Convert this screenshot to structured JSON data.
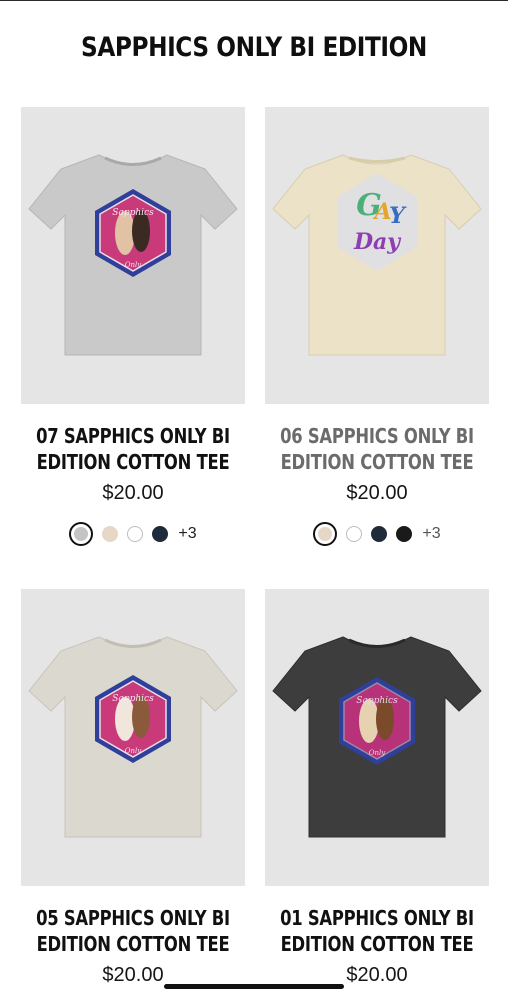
{
  "page": {
    "title": "SAPPHICS ONLY BI EDITION"
  },
  "products": [
    {
      "title_line1": "07 SAPPHICS ONLY BI",
      "title_line2": "EDITION COTTON TEE",
      "price": "$20.00",
      "shirt_color": "#c9c9c9",
      "swatches": [
        "#c4c4c4",
        "#e6d7c6",
        "#ffffff",
        "#1f2a3a"
      ],
      "more_colors": "+3"
    },
    {
      "title_line1": "06 SAPPHICS ONLY BI",
      "title_line2": "EDITION COTTON TEE",
      "price": "$20.00",
      "shirt_color": "#ece2c8",
      "swatches": [
        "#e6d7c6",
        "#ffffff",
        "#1f2a3a",
        "#1a1a1a"
      ],
      "more_colors": "+3"
    },
    {
      "title_line1": "05 SAPPHICS ONLY BI",
      "title_line2": "EDITION COTTON TEE",
      "price": "$20.00",
      "shirt_color": "#dbd8cf"
    },
    {
      "title_line1": "01 SAPPHICS ONLY BI",
      "title_line2": "EDITION COTTON TEE",
      "price": "$20.00",
      "shirt_color": "#3d3d3d"
    }
  ],
  "design": {
    "hex_border_blue": "#2f3f9a",
    "hex_border_purple": "#7a3a94",
    "hex_fill": "#c93a7a",
    "design_text": "Sapphics Only",
    "back_print_text": "GAY Day"
  }
}
